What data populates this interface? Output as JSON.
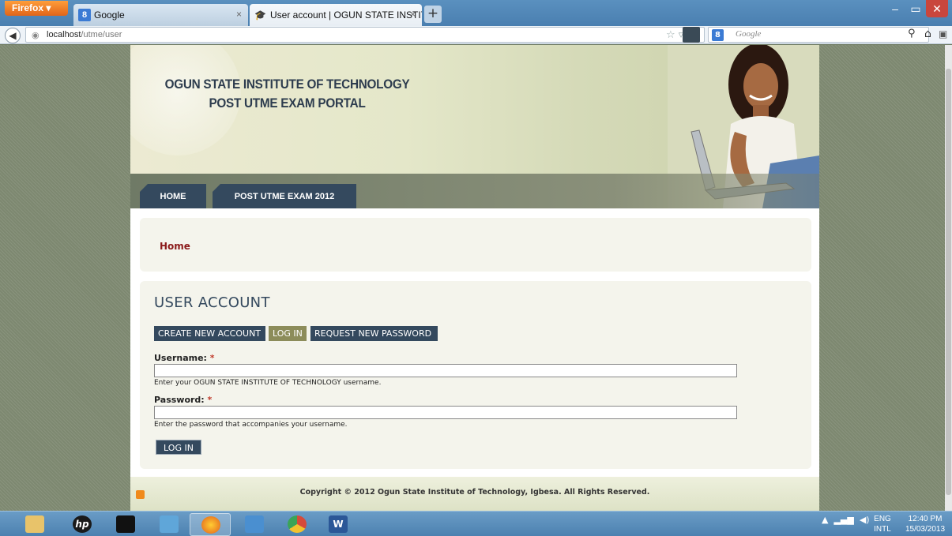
{
  "browser": {
    "menu_label": "Firefox ▾",
    "tabs": [
      {
        "title": "Google",
        "close": "×"
      },
      {
        "title": "User account | OGUN STATE INSTITU...",
        "close": "×"
      }
    ],
    "new_tab": "+",
    "controls": {
      "minimize": "–",
      "maximize": "▭",
      "close": "✕"
    },
    "url_host": "localhost",
    "url_path": "/utme/user",
    "search_engine_glyph": "8",
    "search_placeholder": "Google"
  },
  "site": {
    "title_line1": "OGUN STATE INSTITUTE OF TECHNOLOGY",
    "title_line2": "POST UTME EXAM PORTAL",
    "nav": [
      {
        "label": "HOME"
      },
      {
        "label": "POST UTME EXAM 2012"
      }
    ],
    "breadcrumb": "Home"
  },
  "content": {
    "page_title": "USER ACCOUNT",
    "tabs": [
      {
        "label": "CREATE NEW ACCOUNT",
        "active": false
      },
      {
        "label": "LOG IN",
        "active": true
      },
      {
        "label": "REQUEST NEW PASSWORD",
        "active": false
      }
    ],
    "username": {
      "label": "Username:",
      "required_mark": "*",
      "value": "",
      "description": "Enter your OGUN STATE INSTITUTE OF TECHNOLOGY username."
    },
    "password": {
      "label": "Password:",
      "required_mark": "*",
      "value": "",
      "description": "Enter the password that accompanies your username."
    },
    "submit_label": "LOG IN"
  },
  "footer": {
    "copyright": "Copyright © 2012 Ogun State Institute of Technology, Igbesa. All Rights Reserved."
  },
  "taskbar": {
    "language": "ENG",
    "layout": "INTL",
    "time": "12:40 PM",
    "date": "15/03/2013",
    "word_glyph": "W",
    "hp_glyph": "hp"
  },
  "colors": {
    "nav_blue": "#34495e",
    "active_tab": "#8c8c5a",
    "breadcrumb": "#8b1a1a",
    "required": "#c03a2b"
  }
}
